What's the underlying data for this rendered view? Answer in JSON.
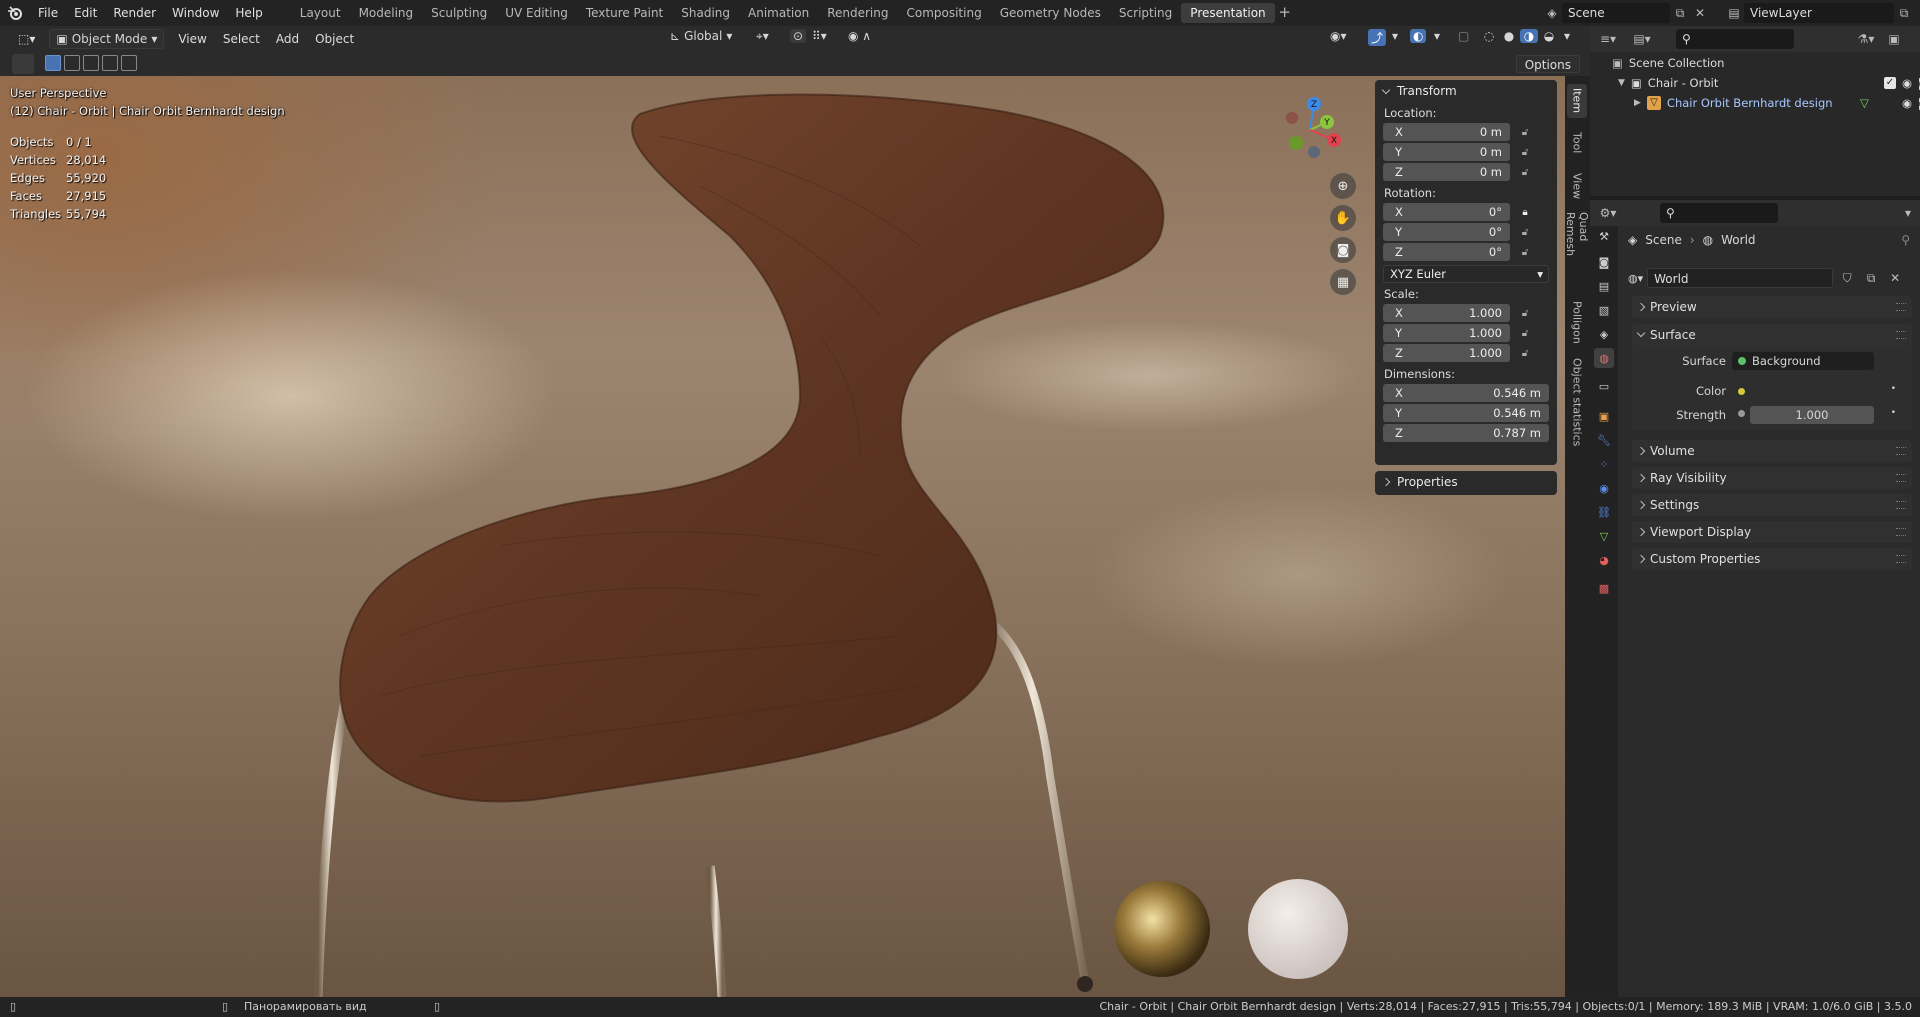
{
  "topbar": {
    "menus": [
      "File",
      "Edit",
      "Render",
      "Window",
      "Help"
    ],
    "workspaces": [
      "Layout",
      "Modeling",
      "Sculpting",
      "UV Editing",
      "Texture Paint",
      "Shading",
      "Animation",
      "Rendering",
      "Compositing",
      "Geometry Nodes",
      "Scripting",
      "Presentation"
    ],
    "active_workspace": "Presentation",
    "add_tab": "+",
    "scene_name": "Scene",
    "view_layer": "ViewLayer"
  },
  "viewport_header": {
    "mode": "Object Mode",
    "menus": [
      "View",
      "Select",
      "Add",
      "Object"
    ],
    "orientation": "Global",
    "options_label": "Options"
  },
  "viewport": {
    "view_name": "User Perspective",
    "object_line": "(12) Chair - Orbit | Chair Orbit Bernhardt design",
    "stats": [
      {
        "key": "Objects",
        "value": "0 / 1"
      },
      {
        "key": "Vertices",
        "value": "28,014"
      },
      {
        "key": "Edges",
        "value": "55,920"
      },
      {
        "key": "Faces",
        "value": "27,915"
      },
      {
        "key": "Triangles",
        "value": "55,794"
      }
    ],
    "gizmo": {
      "x": "X",
      "y": "Y",
      "z": "Z"
    }
  },
  "npanel": {
    "transform_title": "Transform",
    "location_label": "Location:",
    "location": [
      {
        "axis": "X",
        "value": "0 m"
      },
      {
        "axis": "Y",
        "value": "0 m"
      },
      {
        "axis": "Z",
        "value": "0 m"
      }
    ],
    "rotation_label": "Rotation:",
    "rotation": [
      {
        "axis": "X",
        "value": "0°"
      },
      {
        "axis": "Y",
        "value": "0°"
      },
      {
        "axis": "Z",
        "value": "0°"
      }
    ],
    "rotation_mode": "XYZ Euler",
    "scale_label": "Scale:",
    "scale": [
      {
        "axis": "X",
        "value": "1.000"
      },
      {
        "axis": "Y",
        "value": "1.000"
      },
      {
        "axis": "Z",
        "value": "1.000"
      }
    ],
    "dimensions_label": "Dimensions:",
    "dimensions": [
      {
        "axis": "X",
        "value": "0.546 m"
      },
      {
        "axis": "Y",
        "value": "0.546 m"
      },
      {
        "axis": "Z",
        "value": "0.787 m"
      }
    ],
    "properties_title": "Properties"
  },
  "sidetabs": [
    "Item",
    "Tool",
    "View",
    "Quad Remesh",
    "Polligon",
    "Object statistics"
  ],
  "outliner": {
    "root": "Scene Collection",
    "collection": "Chair - Orbit",
    "object": "Chair Orbit Bernhardt design"
  },
  "properties": {
    "breadcrumb_scene": "Scene",
    "breadcrumb_world": "World",
    "world_name": "World",
    "panels": {
      "preview": "Preview",
      "surface": "Surface",
      "volume": "Volume",
      "ray_visibility": "Ray Visibility",
      "settings": "Settings",
      "viewport_display": "Viewport Display",
      "custom_properties": "Custom Properties"
    },
    "surface_label": "Surface",
    "surface_value": "Background",
    "color_label": "Color",
    "strength_label": "Strength",
    "strength_value": "1.000"
  },
  "statusbar": {
    "hint": "Панорамировать вид",
    "info": "Chair - Orbit | Chair Orbit Bernhardt design | Verts:28,014 | Faces:27,915 | Tris:55,794 | Objects:0/1 | Memory: 189.3 MiB | VRAM: 1.0/6.0 GiB | 3.5.0"
  },
  "colors": {
    "accent": "#4772b3",
    "active_tab": "#3d3d3d",
    "x_axis": "#e0434f",
    "y_axis": "#8cc53f",
    "z_axis": "#3d8be8"
  }
}
